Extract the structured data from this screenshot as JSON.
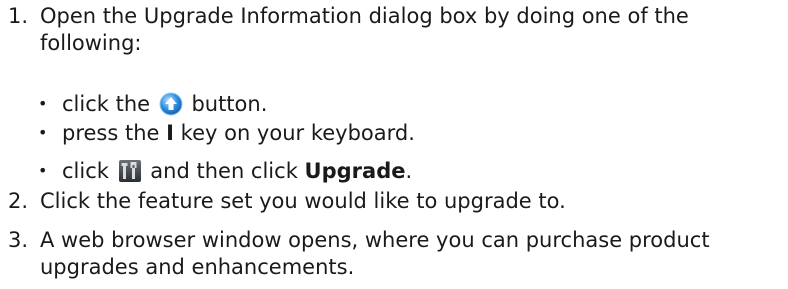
{
  "steps": [
    {
      "number": "1.",
      "line1": "Open the Upgrade Information dialog box by doing one of the",
      "line2": "following:"
    },
    {
      "number": "2.",
      "text": "Click the feature set you would like to upgrade to."
    },
    {
      "number": "3.",
      "line1": "A web browser window opens, where you can purchase product",
      "line2": "upgrades and enhancements."
    }
  ],
  "bullets": [
    {
      "marker": "•",
      "pre": "click the",
      "icon": "upgrade-arrow-icon",
      "post": "button."
    },
    {
      "marker": "•",
      "pre": "press the",
      "bold": "I",
      "post": "key on your keyboard."
    },
    {
      "marker": "•",
      "pre": "click",
      "icon": "tools-icon",
      "post": "and then click",
      "bold": "Upgrade",
      "end": "."
    }
  ],
  "colors": {
    "text": "#1a1a1a",
    "upgrade_icon_blue": "#2e8fe0",
    "tools_icon_dark": "#3a3f45"
  }
}
